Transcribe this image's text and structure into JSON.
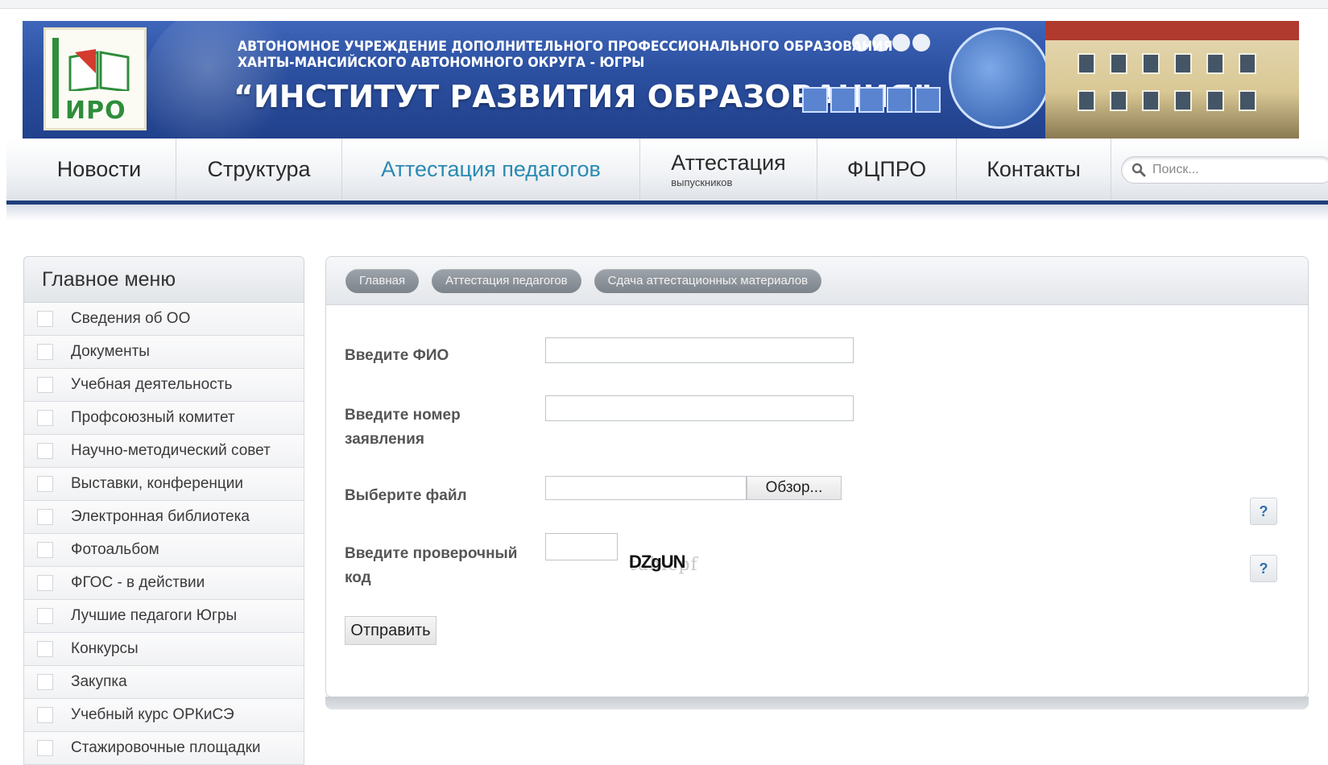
{
  "banner": {
    "logo_text": "ИРО",
    "line1": "АВТОНОМНОЕ УЧРЕЖДЕНИЕ ДОПОЛНИТЕЛЬНОГО ПРОФЕССИОНАЛЬНОГО ОБРАЗОВАНИЯ",
    "line2": "ХАНТЫ-МАНСИЙСКОГО АВТОНОМНОГО ОКРУГА - ЮГРЫ",
    "title": "“ИНСТИТУТ РАЗВИТИЯ ОБРАЗОВАНИЯ”"
  },
  "nav": {
    "items": [
      {
        "label": "Новости"
      },
      {
        "label": "Структура"
      },
      {
        "label": "Аттестация педагогов"
      },
      {
        "label": "Аттестация",
        "sub": "выпускников"
      },
      {
        "label": "ФЦПРО"
      },
      {
        "label": "Контакты"
      }
    ],
    "active_index": 2,
    "active_color": "#2a8ab3",
    "search_placeholder": "Поиск..."
  },
  "sidebar": {
    "title": "Главное меню",
    "items": [
      {
        "label": "Сведения об ОО"
      },
      {
        "label": "Документы"
      },
      {
        "label": "Учебная деятельность"
      },
      {
        "label": "Профсоюзный комитет"
      },
      {
        "label": "Научно-методический совет"
      },
      {
        "label": "Выставки, конференции"
      },
      {
        "label": "Электронная библиотека"
      },
      {
        "label": "Фотоальбом"
      },
      {
        "label": "ФГОС - в действии"
      },
      {
        "label": "Лучшие педагоги Югры"
      },
      {
        "label": "Конкурсы"
      },
      {
        "label": "Закупка"
      },
      {
        "label": "Учебный курс ОРКиСЭ"
      },
      {
        "label": "Стажировочные площадки"
      }
    ]
  },
  "breadcrumbs": [
    {
      "label": "Главная"
    },
    {
      "label": "Аттестация педагогов"
    },
    {
      "label": "Сдача аттестационных материалов"
    }
  ],
  "form": {
    "fio_label": "Введите ФИО",
    "fio_value": "",
    "number_label_line1": "Введите номер",
    "number_label_line2": "заявления",
    "number_value": "",
    "file_label": "Выберите файл",
    "file_button": "Обзор...",
    "captcha_label_line1": "Введите проверочный",
    "captcha_label_line2": "код",
    "captcha_value": "",
    "captcha_text": "DZgUN",
    "captcha_noise": "tuhlcpf",
    "help_label": "?",
    "submit_label": "Отправить"
  }
}
